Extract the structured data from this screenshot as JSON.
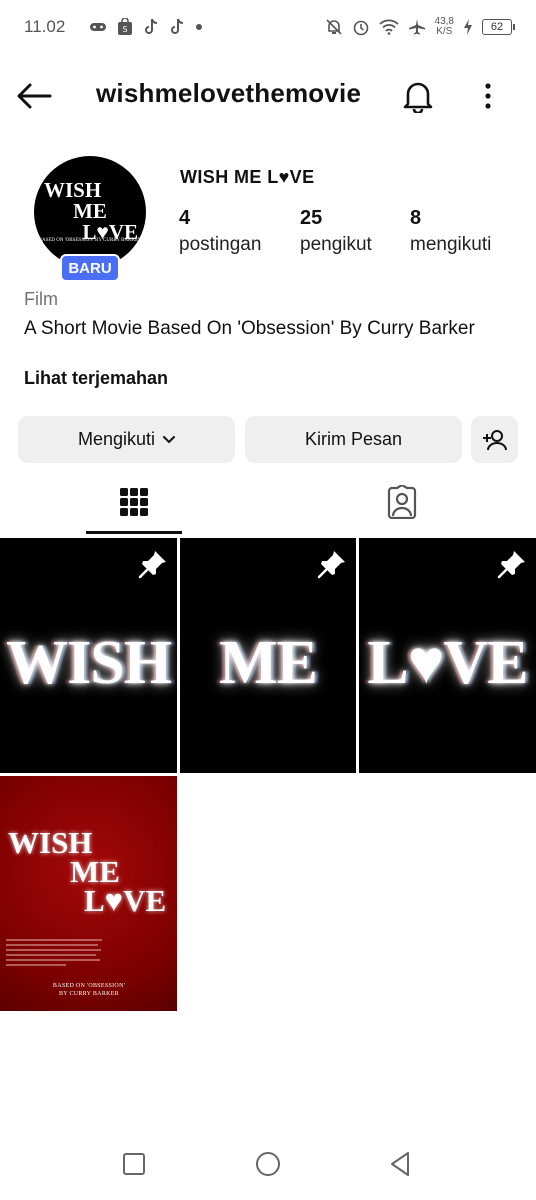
{
  "status_bar": {
    "time": "11.02",
    "net_speed_value": "43,8",
    "net_speed_unit": "K/S",
    "battery": "62",
    "left_icons": [
      "game-controller-icon",
      "shopping-bag-icon",
      "tiktok-icon",
      "tiktok-icon",
      "dot-icon"
    ],
    "right_icons": [
      "mute-icon",
      "alarm-icon",
      "wifi-icon",
      "airplane-icon",
      "charging-icon"
    ]
  },
  "header": {
    "username": "wishmelovethemovie",
    "icons": [
      "back-arrow-icon",
      "bell-icon",
      "more-vertical-icon"
    ]
  },
  "profile": {
    "avatar_logo_lines": [
      "WISH",
      "ME",
      "L♥VE"
    ],
    "avatar_small_text": "BASED ON 'OBSESSION' BY CURRY BARKER",
    "new_badge": "BARU",
    "display_name": "WISH ME L♥VE",
    "stats": [
      {
        "value": "4",
        "label": "postingan"
      },
      {
        "value": "25",
        "label": "pengikut"
      },
      {
        "value": "8",
        "label": "mengikuti"
      }
    ],
    "category": "Film",
    "bio": "A Short Movie Based On 'Obsession' By Curry Barker",
    "see_translation": "Lihat terjemahan"
  },
  "actions": {
    "following_label": "Mengikuti",
    "message_label": "Kirim Pesan",
    "add_person_icon": "add-person-icon"
  },
  "tabs": [
    {
      "icon": "grid-icon",
      "active": true
    },
    {
      "icon": "tagged-person-icon",
      "active": false
    }
  ],
  "posts": [
    {
      "type": "word",
      "text": "WISH",
      "pinned": true
    },
    {
      "type": "word",
      "text": "ME",
      "pinned": true
    },
    {
      "type": "word",
      "text": "L♥VE",
      "pinned": true
    },
    {
      "type": "poster",
      "title_lines": [
        "WISH",
        "ME",
        "L♥VE"
      ],
      "credit_lines": [
        "BASED ON 'OBSESSION'",
        "BY CURRY BARKER"
      ],
      "pinned": false
    }
  ],
  "navbar": {
    "icons": [
      "recents-square-icon",
      "home-circle-icon",
      "back-triangle-icon"
    ]
  },
  "colors": {
    "accent_badge": "#4a6ef5",
    "button_bg": "#efefef",
    "poster_red": "#8e0000",
    "muted_text": "#737373"
  }
}
